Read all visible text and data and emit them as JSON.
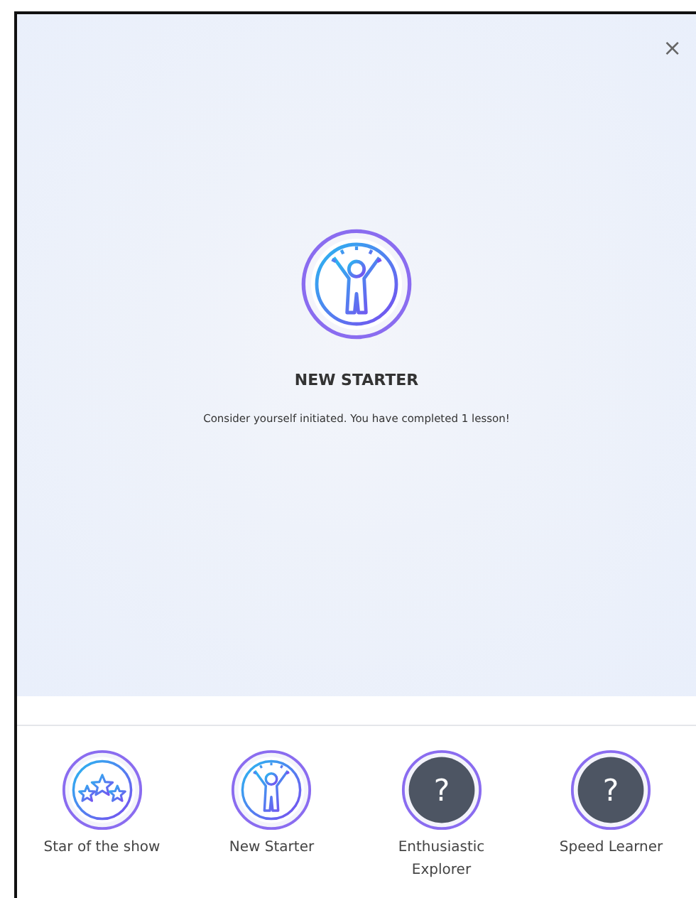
{
  "close": {
    "symbol": "×"
  },
  "featured": {
    "kind": "starter",
    "title": "NEW STARTER",
    "message": "Consider yourself initiated. You have completed 1 lesson!"
  },
  "badges": [
    {
      "kind": "star",
      "label": "Star of the show",
      "locked": false
    },
    {
      "kind": "starter",
      "label": "New Starter",
      "locked": false
    },
    {
      "label": "Enthusiastic Explorer",
      "locked": true,
      "symbol": "?"
    },
    {
      "label": "Speed Learner",
      "locked": true,
      "symbol": "?"
    }
  ]
}
